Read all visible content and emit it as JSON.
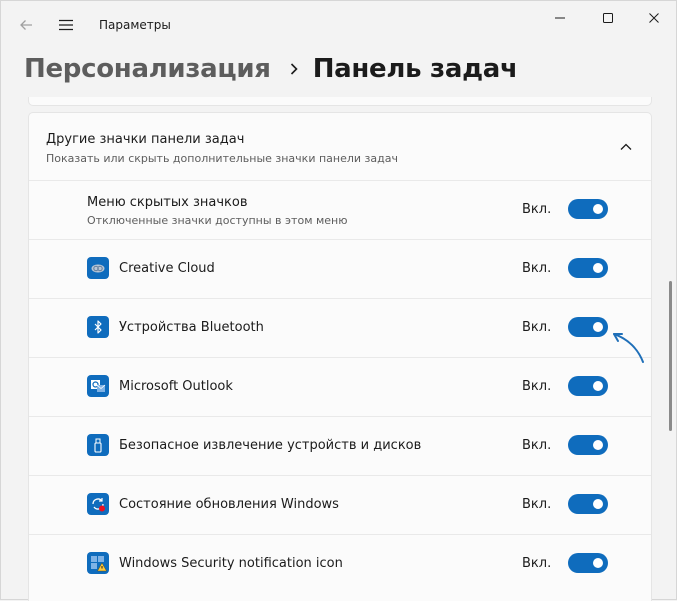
{
  "window": {
    "app_title": "Параметры",
    "icons": {
      "back": "back-arrow-icon",
      "menu": "hamburger-menu-icon",
      "minimize": "minimize-icon",
      "maximize": "maximize-icon",
      "close": "close-icon"
    }
  },
  "header": {
    "parent": "Персонализация",
    "current": "Панель задач"
  },
  "group": {
    "title": "Другие значки панели задач",
    "subtitle": "Показать или скрыть дополнительные значки панели задач",
    "expanded": true
  },
  "hidden_menu": {
    "title": "Меню скрытых значков",
    "description": "Отключенные значки доступны в этом меню",
    "state": "Вкл.",
    "on": true
  },
  "items": [
    {
      "label": "Creative Cloud",
      "state": "Вкл.",
      "on": true,
      "icon": "creative-cloud-icon"
    },
    {
      "label": "Устройства Bluetooth",
      "state": "Вкл.",
      "on": true,
      "icon": "bluetooth-icon"
    },
    {
      "label": "Microsoft Outlook",
      "state": "Вкл.",
      "on": true,
      "icon": "outlook-icon"
    },
    {
      "label": "Безопасное извлечение устройств и дисков",
      "state": "Вкл.",
      "on": true,
      "icon": "usb-drive-icon"
    },
    {
      "label": "Состояние обновления Windows",
      "state": "Вкл.",
      "on": true,
      "icon": "windows-update-icon"
    },
    {
      "label": "Windows Security notification icon",
      "state": "Вкл.",
      "on": true,
      "icon": "windows-security-icon"
    }
  ],
  "colors": {
    "accent": "#0f6cbd",
    "background": "#f3f3f3",
    "card": "#fbfbfb",
    "annotation": "#1f6fb8"
  }
}
